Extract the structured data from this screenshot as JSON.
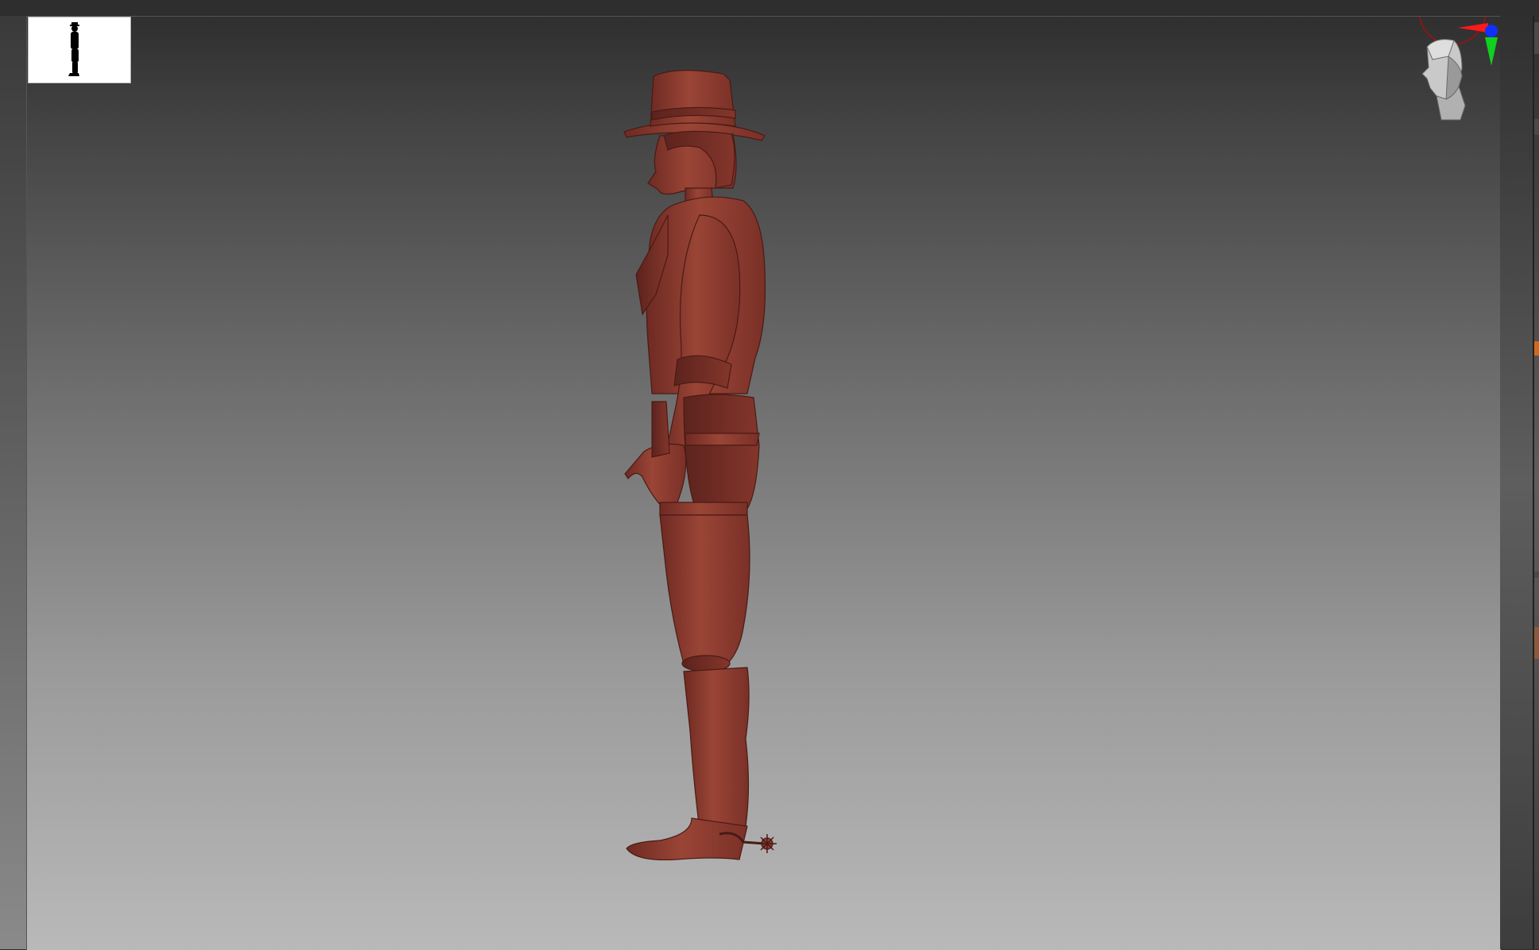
{
  "app": {
    "view": "side-orthographic"
  },
  "viewport": {
    "background_top": "#2f2f2f",
    "background_bottom": "#b9b9b9",
    "model_color": "#8a3a30"
  },
  "navigator": {
    "thumbnail_icon": "silhouette-thumbnail-icon",
    "gizmo_icon": "axis-gizmo-icon",
    "head_icon": "head-orientation-icon",
    "axis_colors": {
      "x": "#ff1a1a",
      "y": "#10d020",
      "z": "#1030ff"
    }
  }
}
